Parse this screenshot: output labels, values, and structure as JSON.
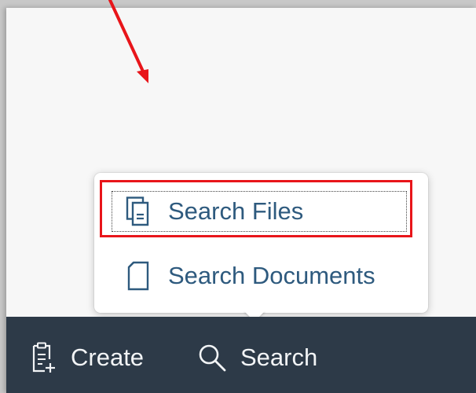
{
  "menu": {
    "items": [
      {
        "label": "Search Files",
        "icon": "files-icon"
      },
      {
        "label": "Search Documents",
        "icon": "document-icon"
      }
    ]
  },
  "footer": {
    "create_label": "Create",
    "search_label": "Search",
    "create_icon": "clipboard-add-icon",
    "search_icon": "search-icon"
  },
  "colors": {
    "accent": "#2e5a7e",
    "footer_bg": "#2d3a48",
    "highlight": "#e8151a"
  }
}
